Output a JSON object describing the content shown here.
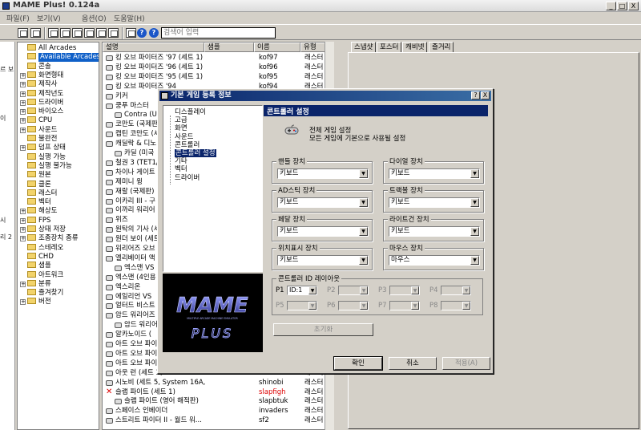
{
  "app": {
    "title": "MAME Plus! 0.124a",
    "window_buttons": [
      "_",
      "□",
      "X"
    ]
  },
  "menu": [
    "파일(F)",
    "보기(V)",
    "옵션(O)",
    "도움말(H)"
  ],
  "search": {
    "placeholder": "검색어 입력"
  },
  "left_strip": [
    "르 보",
    "이",
    "시",
    "리 2"
  ],
  "tree": {
    "items": [
      {
        "label": "All Arcades",
        "exp": ""
      },
      {
        "label": "Available Arcades",
        "exp": "",
        "selected": true
      },
      {
        "label": "콘솔",
        "exp": ""
      },
      {
        "label": "화면형태",
        "exp": "+"
      },
      {
        "label": "제작사",
        "exp": "+"
      },
      {
        "label": "제작년도",
        "exp": "+"
      },
      {
        "label": "드라이버",
        "exp": "+"
      },
      {
        "label": "바이오스",
        "exp": "+"
      },
      {
        "label": "CPU",
        "exp": "+"
      },
      {
        "label": "사운드",
        "exp": "+"
      },
      {
        "label": "불완전",
        "exp": ""
      },
      {
        "label": "덤프 상태",
        "exp": "+"
      },
      {
        "label": "실행 가능",
        "exp": ""
      },
      {
        "label": "실행 불가능",
        "exp": ""
      },
      {
        "label": "원본",
        "exp": ""
      },
      {
        "label": "클론",
        "exp": ""
      },
      {
        "label": "래스터",
        "exp": ""
      },
      {
        "label": "벡터",
        "exp": ""
      },
      {
        "label": "해상도",
        "exp": "+"
      },
      {
        "label": "FPS",
        "exp": "+"
      },
      {
        "label": "상태 저장",
        "exp": "+"
      },
      {
        "label": "조종장치 종류",
        "exp": "+"
      },
      {
        "label": "스테레오",
        "exp": ""
      },
      {
        "label": "CHD",
        "exp": ""
      },
      {
        "label": "샘플",
        "exp": ""
      },
      {
        "label": "아트워크",
        "exp": ""
      },
      {
        "label": "분류",
        "exp": "+"
      },
      {
        "label": "즐겨찾기",
        "exp": ""
      },
      {
        "label": "버전",
        "exp": "+"
      }
    ]
  },
  "gamelist": {
    "columns": [
      "설명",
      "샘플",
      "이름",
      "유형"
    ],
    "rows": [
      {
        "name": "킹 오브 파이터즈 '97 (세트 1)",
        "rom": "kof97",
        "type": "래스터"
      },
      {
        "name": "킹 오브 파이터즈 '96 (세트 1)",
        "rom": "kof96",
        "type": "래스터"
      },
      {
        "name": "킹 오브 파이터즈 '95 (세트 1)",
        "rom": "kof95",
        "type": "래스터"
      },
      {
        "name": "킹 오브 파이터즈 '94",
        "rom": "kof94",
        "type": "래스터"
      },
      {
        "name": "키커",
        "rom": "",
        "type": ""
      },
      {
        "name": "쿵푸 마스터",
        "rom": "",
        "type": ""
      },
      {
        "name": "Contra (US",
        "rom": "",
        "type": "",
        "indent": true
      },
      {
        "name": "코만도 (국제판",
        "rom": "",
        "type": ""
      },
      {
        "name": "캡틴 코만도 (세",
        "rom": "",
        "type": ""
      },
      {
        "name": "캐딜락 & 디노",
        "rom": "",
        "type": ""
      },
      {
        "name": "카딜 (미국",
        "rom": "",
        "type": "",
        "indent": true
      },
      {
        "name": "철권 3 (TET1/",
        "rom": "",
        "type": ""
      },
      {
        "name": "차이나 게이트",
        "rom": "",
        "type": ""
      },
      {
        "name": "제미니 윙",
        "rom": "",
        "type": ""
      },
      {
        "name": "재랄 (국제판)",
        "rom": "",
        "type": ""
      },
      {
        "name": "이카리 III - 구",
        "rom": "",
        "type": ""
      },
      {
        "name": "이까리 워리어",
        "rom": "",
        "type": ""
      },
      {
        "name": "위즈",
        "rom": "",
        "type": ""
      },
      {
        "name": "원탁의 기사 (세",
        "rom": "",
        "type": ""
      },
      {
        "name": "원더 보이 (세트",
        "rom": "",
        "type": ""
      },
      {
        "name": "워리어즈 오브",
        "rom": "",
        "type": ""
      },
      {
        "name": "엘리베이터 액",
        "rom": "",
        "type": ""
      },
      {
        "name": "엑스맨 VS",
        "rom": "",
        "type": "",
        "indent": true
      },
      {
        "name": "엑스맨 (4인용",
        "rom": "",
        "type": ""
      },
      {
        "name": "엑스리온",
        "rom": "",
        "type": ""
      },
      {
        "name": "에일리언 VS",
        "rom": "",
        "type": ""
      },
      {
        "name": "얼터드 비스트",
        "rom": "",
        "type": ""
      },
      {
        "name": "암드 워리어즈",
        "rom": "",
        "type": ""
      },
      {
        "name": "암드 워리어",
        "rom": "",
        "type": "",
        "indent": true
      },
      {
        "name": "알카노이드 (",
        "rom": "",
        "type": ""
      },
      {
        "name": "아트 오브 파이",
        "rom": "",
        "type": ""
      },
      {
        "name": "아트 오브 파이",
        "rom": "",
        "type": ""
      },
      {
        "name": "아트 오브 파이",
        "rom": "",
        "type": ""
      },
      {
        "name": "아웃 런 (세트 3)",
        "rom": "outrun",
        "type": "래스터"
      },
      {
        "name": "시노비 (세트 5, System 16A,",
        "rom": "shinobi",
        "type": "래스터"
      },
      {
        "name": "슬랩 파이트 (세트 1)",
        "rom": "slapfigh",
        "type": "래스터",
        "red": true
      },
      {
        "name": "슬랩 파이트 (영어 해적판)",
        "rom": "slapbtuk",
        "type": "래스터",
        "indent": true
      },
      {
        "name": "스페이스 인베이더",
        "rom": "invaders",
        "type": "래스터"
      },
      {
        "name": "스트리트 파이터 II - 월드 워...",
        "rom": "sf2",
        "type": "래스터"
      }
    ]
  },
  "right_tabs": [
    "스냅샷",
    "포스터",
    "캐비넷",
    "즐거리"
  ],
  "dialog": {
    "title": "기본 게임 등록 정보",
    "title_buttons": [
      "?",
      "X"
    ],
    "tree_items": [
      "디스플레이",
      "고급",
      "화면",
      "사운드",
      "콘트롤러",
      "콘트롤러 설정",
      "기타",
      "벡터",
      "드라이버"
    ],
    "section_title": "콘트롤러 설정",
    "desc_line1": "전체 게임 설정",
    "desc_line2": "모든 게임에 기본으로 사용될 설정",
    "logo_top": "MAME",
    "logo_sub": "MULTIPLE ARCADE MACHINE EMULATOR",
    "logo_bottom": "PLUS",
    "groups": [
      {
        "label": "핸들 장치",
        "value": "키보드"
      },
      {
        "label": "다이얼 장치",
        "value": "키보드"
      },
      {
        "label": "AD스틱 장치",
        "value": "키보드"
      },
      {
        "label": "트랙볼 장치",
        "value": "키보드"
      },
      {
        "label": "페달 장치",
        "value": "키보드"
      },
      {
        "label": "라이트건 장치",
        "value": "키보드"
      },
      {
        "label": "위치표시 장치",
        "value": "키보드"
      },
      {
        "label": "마우스 장치",
        "value": "마우스"
      }
    ],
    "id_section": {
      "label": "콘트롤러 ID 레이아웃",
      "players": [
        {
          "label": "P1",
          "value": "ID:1",
          "enabled": true
        },
        {
          "label": "P2",
          "value": "",
          "enabled": false
        },
        {
          "label": "P3",
          "value": "",
          "enabled": false
        },
        {
          "label": "P4",
          "value": "",
          "enabled": false
        },
        {
          "label": "P5",
          "value": "",
          "enabled": false
        },
        {
          "label": "P6",
          "value": "",
          "enabled": false
        },
        {
          "label": "P7",
          "value": "",
          "enabled": false
        },
        {
          "label": "P8",
          "value": "",
          "enabled": false
        }
      ]
    },
    "reset_label": "초기화",
    "ok_label": "확인",
    "cancel_label": "취소",
    "apply_label": "적용(A)"
  }
}
